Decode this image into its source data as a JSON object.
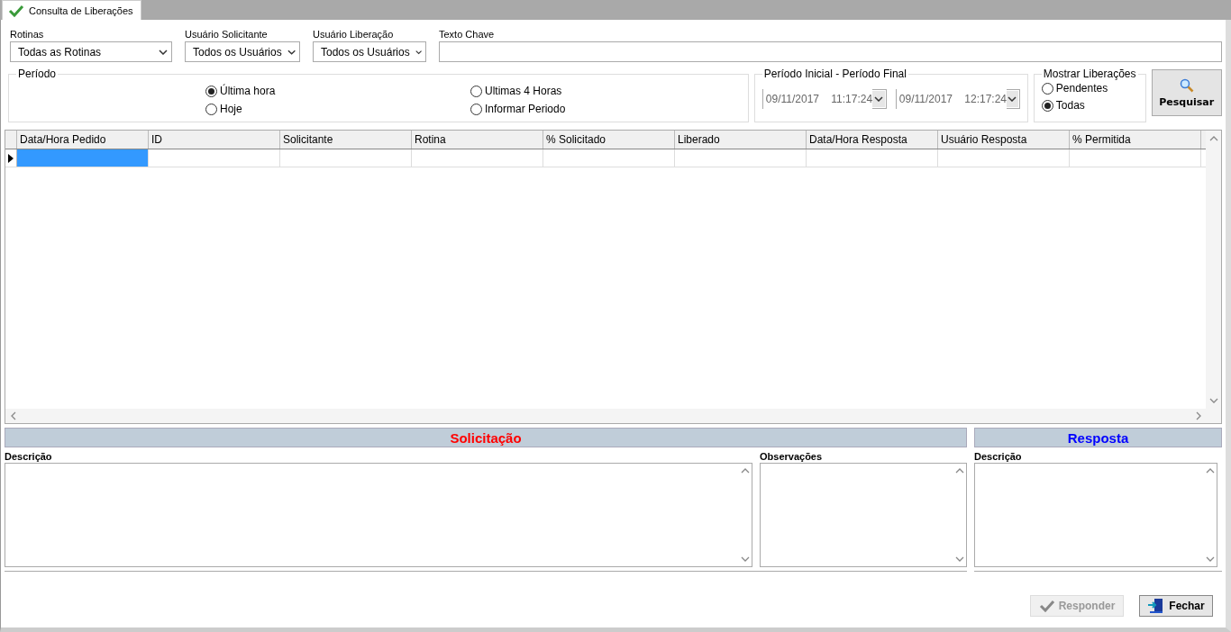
{
  "tab": {
    "label": "Consulta de Liberações",
    "selected": true
  },
  "filters": [
    {
      "kind": "select",
      "label": "Rotinas",
      "value": "Todas as Rotinas"
    },
    {
      "kind": "select",
      "label": "Usuário Solicitante",
      "value": "Todos os Usuários"
    },
    {
      "kind": "select",
      "label": "Usuário Liberação",
      "value": "Todos os Usuários"
    },
    {
      "kind": "text",
      "label": "Texto Chave"
    }
  ],
  "periodo": {
    "title": "Período",
    "options": [
      {
        "label": "Última hora",
        "selected": true
      },
      {
        "label": "Hoje",
        "selected": false
      },
      {
        "label": "Ultimas 4 Horas",
        "selected": false
      },
      {
        "label": "Informar Periodo",
        "selected": false
      }
    ]
  },
  "date_range": {
    "title": "Período Inicial -  Período Final",
    "start": "09/11/2017    11:17:24",
    "end": "09/11/2017    12:17:24",
    "disabled": true
  },
  "mostrar": {
    "title": "Mostrar Liberações",
    "options": [
      {
        "label": "Pendentes",
        "selected": false
      },
      {
        "label": "Todas",
        "selected": true
      }
    ]
  },
  "search_button": {
    "label": "Pesquisar"
  },
  "grid": {
    "columns": [
      "Data/Hora Pedido",
      "ID",
      "Solicitante",
      "Rotina",
      "%  Solicitado",
      "Liberado",
      "Data/Hora Resposta",
      "Usuário Resposta",
      "% Permitida"
    ],
    "rows": [
      {
        "selected": true
      }
    ]
  },
  "panels": [
    {
      "title": "Solicitação",
      "color": "#ff0000",
      "fields": [
        "Descrição",
        "Observações"
      ]
    },
    {
      "title": "Resposta",
      "color": "#0000ff",
      "fields": [
        "Descrição"
      ]
    }
  ],
  "buttons": [
    {
      "kind": "check",
      "label": "Responder",
      "disabled": true
    },
    {
      "kind": "exit",
      "label": "Fechar",
      "disabled": false
    }
  ]
}
